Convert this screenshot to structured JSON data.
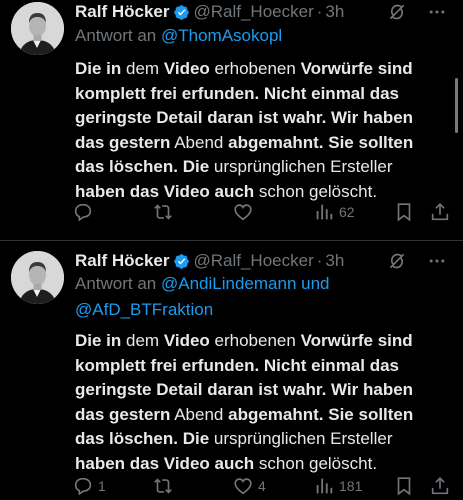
{
  "colors": {
    "background": "#000000",
    "text": "#e7e9ea",
    "muted": "#71767b",
    "link": "#1d9bf0",
    "verified": "#1d9bf0"
  },
  "tweets": [
    {
      "author_name": "Ralf Höcker",
      "handle": "@Ralf_Hoecker",
      "dot": "·",
      "time": "3h",
      "reply_prefix": "Antwort an",
      "reply_to": "@ThomAsokopl",
      "body": {
        "s1": "Die in",
        "s2": " dem ",
        "s3": "Video",
        "s4": " erhobenen ",
        "s5": "Vorwürfe sind komplett frei erfunden. Nicht einmal das geringste Detail daran ist wahr. Wir haben das gestern",
        "s6": " Abend ",
        "s7": "abgemahnt",
        "s8": ". ",
        "s9": "Sie sollten das löschen. Die",
        "s10": " ursprünglichen Ersteller ",
        "s11": "haben das Video auch",
        "s12": " schon gelöscht."
      },
      "actions": {
        "replies": "",
        "retweets": "",
        "likes": "",
        "views": "62"
      },
      "icons": [
        "grok-icon",
        "more-icon",
        "reply-icon",
        "retweet-icon",
        "like-icon",
        "views-icon",
        "bookmark-icon",
        "share-icon"
      ]
    },
    {
      "author_name": "Ralf Höcker",
      "handle": "@Ralf_Hoecker",
      "dot": "·",
      "time": "3h",
      "reply_prefix": "Antwort an",
      "reply_to": "@AndiLindemann und @AfD_BTFraktion",
      "body": {
        "s1": "Die in",
        "s2": " dem ",
        "s3": "Video",
        "s4": " erhobenen ",
        "s5": "Vorwürfe sind komplett frei erfunden. Nicht einmal das geringste Detail daran ist wahr. Wir haben das gestern",
        "s6": " Abend ",
        "s7": "abgemahnt",
        "s8": ". ",
        "s9": "Sie sollten das löschen. Die",
        "s10": " ursprünglichen Ersteller ",
        "s11": "haben das Video auch",
        "s12": " schon gelöscht."
      },
      "actions": {
        "replies": "1",
        "retweets": "",
        "likes": "4",
        "views": "181"
      },
      "icons": [
        "grok-icon",
        "more-icon",
        "reply-icon",
        "retweet-icon",
        "like-icon",
        "views-icon",
        "bookmark-icon",
        "share-icon"
      ]
    }
  ]
}
